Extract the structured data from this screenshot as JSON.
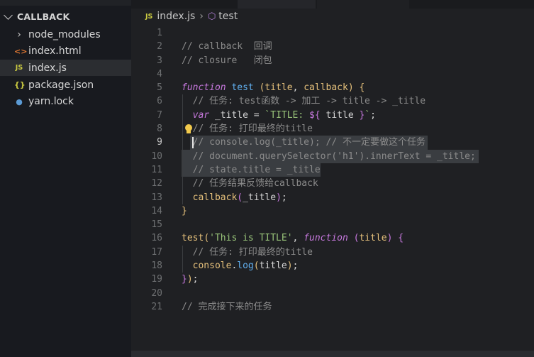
{
  "sidebar": {
    "title": "CALLBACK",
    "files": [
      {
        "label": "node_modules",
        "icon": "folder-chevron-icon",
        "glyph": "›",
        "kind": "folder"
      },
      {
        "label": "index.html",
        "icon": "html-file-icon",
        "glyph": "<>",
        "kind": "html"
      },
      {
        "label": "index.js",
        "icon": "js-file-icon",
        "glyph": "JS",
        "kind": "js",
        "active": true
      },
      {
        "label": "package.json",
        "icon": "json-file-icon",
        "glyph": "{}",
        "kind": "json"
      },
      {
        "label": "yarn.lock",
        "icon": "yarn-file-icon",
        "glyph": "●",
        "kind": "yarn"
      }
    ]
  },
  "breadcrumb": {
    "file_icon": "JS",
    "file": "index.js",
    "separator": "›",
    "symbol": "test"
  },
  "editor": {
    "current_line": 9,
    "lines": [
      {
        "n": "1",
        "tokens": []
      },
      {
        "n": "2",
        "tokens": [
          {
            "t": "// callback  回调",
            "c": "cm"
          }
        ]
      },
      {
        "n": "3",
        "tokens": [
          {
            "t": "// closure   闭包",
            "c": "cm"
          }
        ]
      },
      {
        "n": "4",
        "tokens": []
      },
      {
        "n": "5",
        "tokens": [
          {
            "t": "function",
            "c": "kw"
          },
          {
            "t": " ",
            "c": "pl"
          },
          {
            "t": "test",
            "c": "fn"
          },
          {
            "t": " ",
            "c": "pl"
          },
          {
            "t": "(",
            "c": "br"
          },
          {
            "t": "title",
            "c": "pa"
          },
          {
            "t": ", ",
            "c": "pl"
          },
          {
            "t": "callback",
            "c": "pa"
          },
          {
            "t": ")",
            "c": "br"
          },
          {
            "t": " ",
            "c": "pl"
          },
          {
            "t": "{",
            "c": "br"
          }
        ]
      },
      {
        "n": "6",
        "tokens": [
          {
            "t": "  // 任务: test函数 -> 加工 -> title -> _title",
            "c": "cm"
          }
        ]
      },
      {
        "n": "7",
        "tokens": [
          {
            "t": "  ",
            "c": "pl"
          },
          {
            "t": "var",
            "c": "kw"
          },
          {
            "t": " _title = ",
            "c": "pl"
          },
          {
            "t": "`TITLE: ",
            "c": "st"
          },
          {
            "t": "${",
            "c": "br2"
          },
          {
            "t": " title ",
            "c": "pl"
          },
          {
            "t": "}",
            "c": "br2"
          },
          {
            "t": "`",
            "c": "st"
          },
          {
            "t": ";",
            "c": "pl"
          }
        ]
      },
      {
        "n": "8",
        "tokens": [
          {
            "t": "  // 任务: 打印最终的title",
            "c": "cm"
          }
        ],
        "bulb": true
      },
      {
        "n": "9",
        "tokens": [
          {
            "t": "  // console.log(_title); // 不一定要做这个任务",
            "c": "cm"
          }
        ],
        "sel": [
          83,
          418
        ],
        "cursor": true
      },
      {
        "n": "10",
        "tokens": [
          {
            "t": "  // document.querySelector('h1').innerText = _title;",
            "c": "cm"
          }
        ],
        "sel": [
          71,
          490
        ]
      },
      {
        "n": "11",
        "tokens": [
          {
            "t": "  // state.title = _title",
            "c": "cm"
          }
        ],
        "sel": [
          71,
          267
        ]
      },
      {
        "n": "12",
        "tokens": [
          {
            "t": "  // 任务结果反馈给callback",
            "c": "cm"
          }
        ]
      },
      {
        "n": "13",
        "tokens": [
          {
            "t": "  ",
            "c": "pl"
          },
          {
            "t": "callback",
            "c": "pa"
          },
          {
            "t": "(",
            "c": "br2"
          },
          {
            "t": "_title",
            "c": "pl"
          },
          {
            "t": ")",
            "c": "br2"
          },
          {
            "t": ";",
            "c": "pl"
          }
        ]
      },
      {
        "n": "14",
        "tokens": [
          {
            "t": "}",
            "c": "br"
          }
        ]
      },
      {
        "n": "15",
        "tokens": []
      },
      {
        "n": "16",
        "tokens": [
          {
            "t": "test",
            "c": "pa"
          },
          {
            "t": "(",
            "c": "br"
          },
          {
            "t": "'This is TITLE'",
            "c": "st"
          },
          {
            "t": ", ",
            "c": "pl"
          },
          {
            "t": "function",
            "c": "kw"
          },
          {
            "t": " ",
            "c": "pl"
          },
          {
            "t": "(",
            "c": "br2"
          },
          {
            "t": "title",
            "c": "pa"
          },
          {
            "t": ")",
            "c": "br2"
          },
          {
            "t": " ",
            "c": "pl"
          },
          {
            "t": "{",
            "c": "br2"
          }
        ]
      },
      {
        "n": "17",
        "tokens": [
          {
            "t": "  // 任务: 打印最终的title",
            "c": "cm"
          }
        ]
      },
      {
        "n": "18",
        "tokens": [
          {
            "t": "  ",
            "c": "pl"
          },
          {
            "t": "console",
            "c": "pa"
          },
          {
            "t": ".",
            "c": "pl"
          },
          {
            "t": "log",
            "c": "fn"
          },
          {
            "t": "(",
            "c": "br"
          },
          {
            "t": "title",
            "c": "pl"
          },
          {
            "t": ")",
            "c": "br"
          },
          {
            "t": ";",
            "c": "pl"
          }
        ]
      },
      {
        "n": "19",
        "tokens": [
          {
            "t": "}",
            "c": "br2"
          },
          {
            "t": ")",
            "c": "br"
          },
          {
            "t": ";",
            "c": "pl"
          }
        ]
      },
      {
        "n": "20",
        "tokens": []
      },
      {
        "n": "21",
        "tokens": [
          {
            "t": "// 完成接下来的任务",
            "c": "cm"
          }
        ]
      }
    ]
  }
}
